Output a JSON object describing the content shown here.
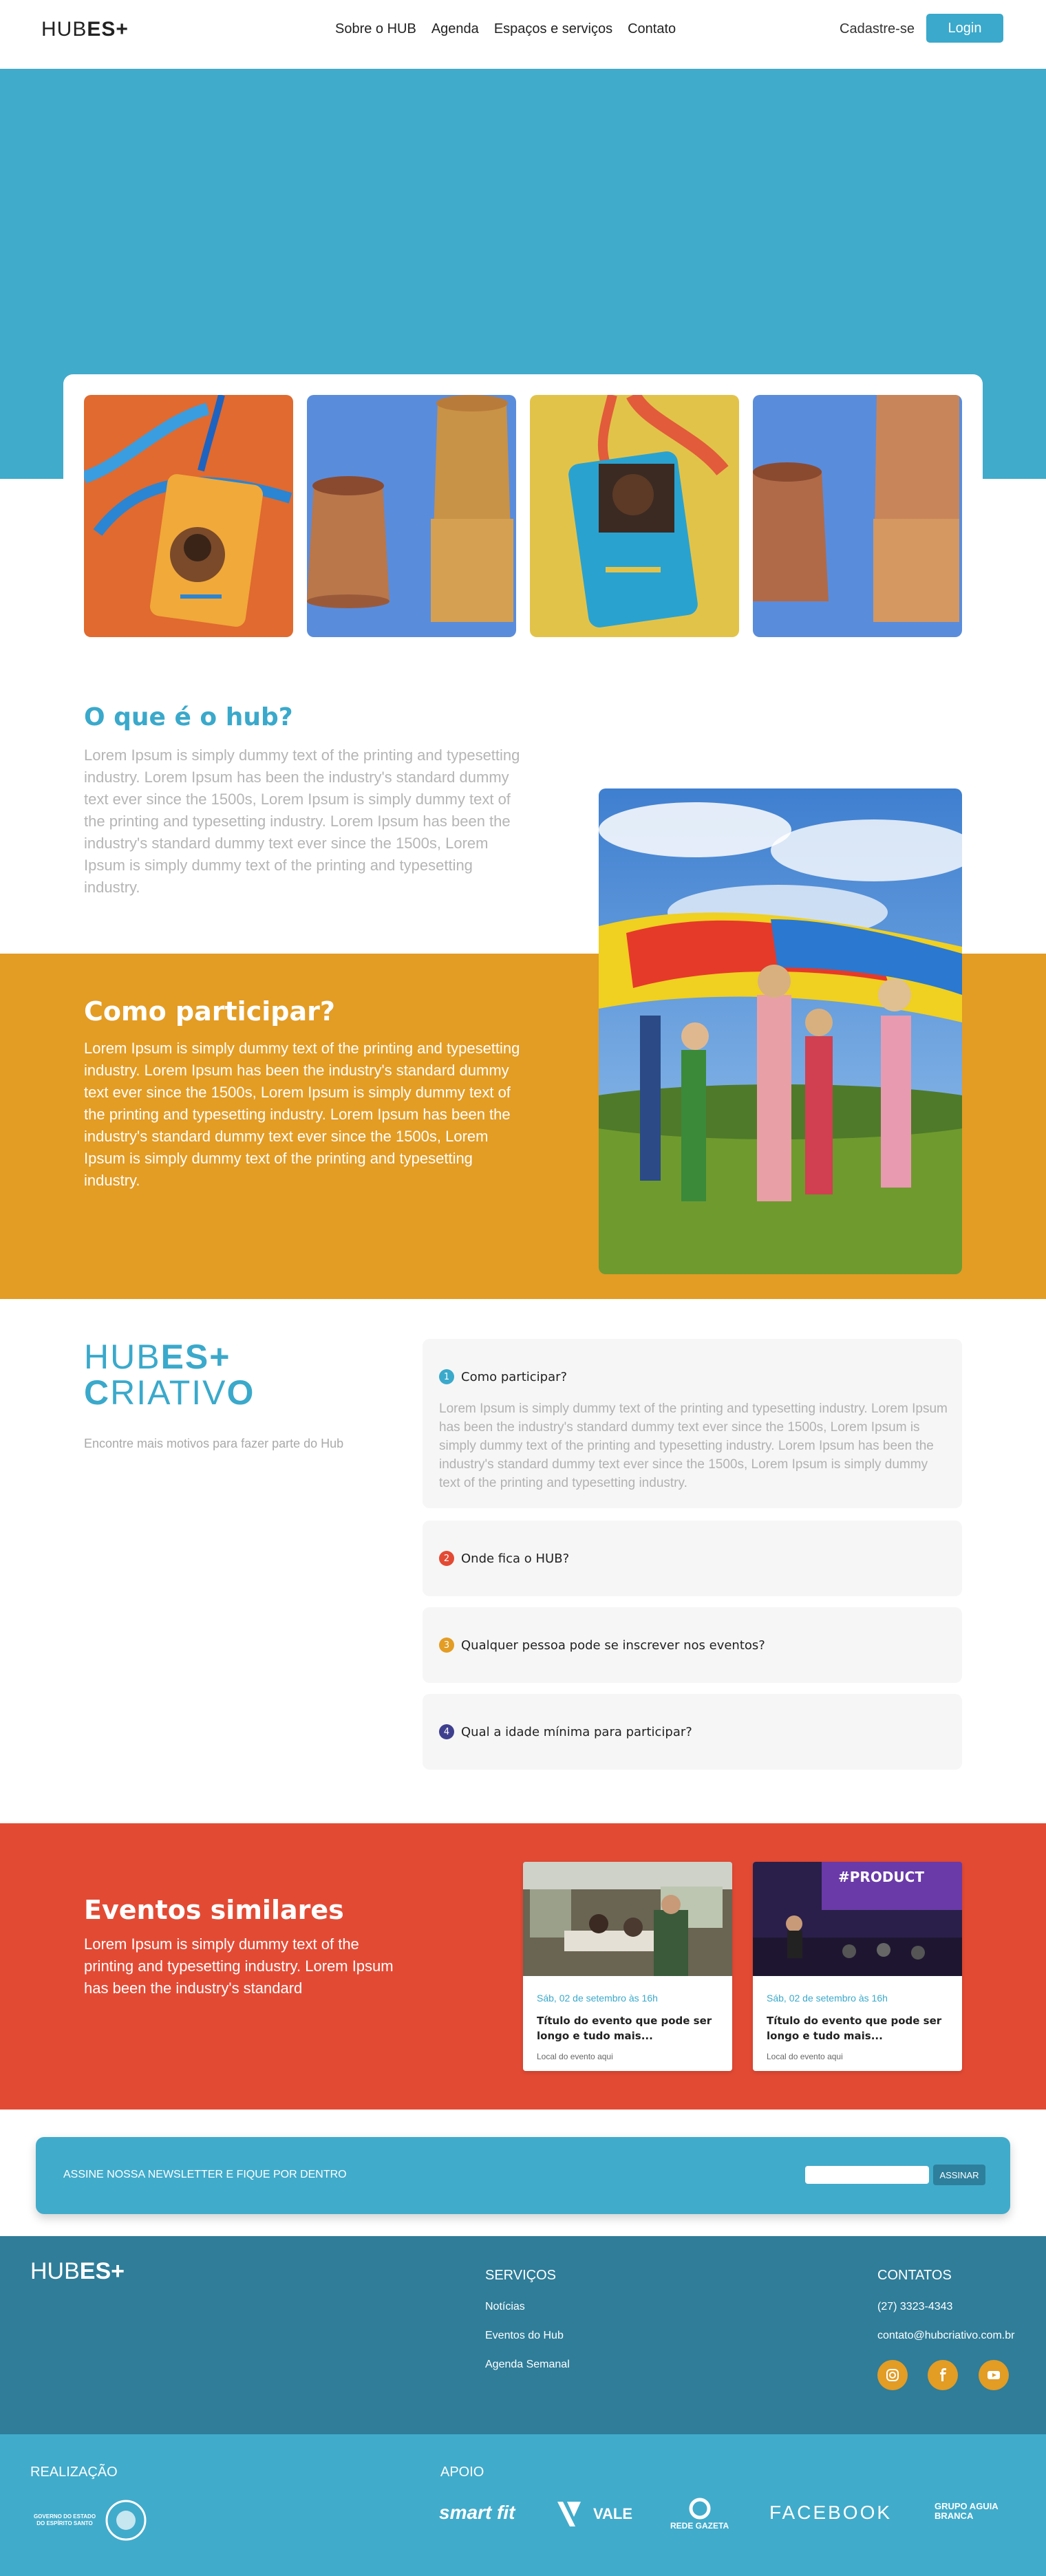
{
  "nav": {
    "logo_thin": "HUB",
    "logo_bold": "ES+",
    "links": [
      "Sobre o HUB",
      "Agenda",
      "Espaços e serviços",
      "Contato"
    ],
    "signup": "Cadastre-se",
    "login": "Login"
  },
  "about": {
    "title": "O que é o hub?",
    "text": "Lorem Ipsum is simply dummy text of the printing and typesetting industry. Lorem Ipsum has been the industry's standard dummy text ever since the 1500s, Lorem Ipsum is simply dummy text of the printing and typesetting industry. Lorem Ipsum has been the industry's standard dummy text ever since the 1500s, Lorem Ipsum is simply dummy text of the printing and typesetting industry."
  },
  "how": {
    "title": "Como participar?",
    "text": "Lorem Ipsum is simply dummy text of the printing and typesetting industry. Lorem Ipsum has been the industry's standard dummy text ever since the 1500s, Lorem Ipsum is simply dummy text of the printing and typesetting industry. Lorem Ipsum has been the industry's standard dummy text ever since the 1500s, Lorem Ipsum is simply dummy text of the printing and typesetting industry."
  },
  "creative": {
    "logo_line1_thin": "HUB",
    "logo_line1_bold": "ES+",
    "logo_line2_bold": "C",
    "logo_line2_thin": "RIATIV",
    "logo_line2_end": "O",
    "subtitle": "Encontre mais motivos para fazer parte do Hub"
  },
  "faq": [
    {
      "num": "1",
      "question": "Como participar?",
      "color": "#3aa9cb",
      "answer": "Lorem Ipsum is simply dummy text of the printing and typesetting industry. Lorem Ipsum has been the industry's standard dummy text ever since the 1500s, Lorem Ipsum is simply dummy text of the printing and typesetting industry. Lorem Ipsum has been the industry's standard dummy text ever since the 1500s, Lorem Ipsum is simply dummy text of the printing and typesetting industry."
    },
    {
      "num": "2",
      "question": "Onde fica o HUB?",
      "color": "#e34a34"
    },
    {
      "num": "3",
      "question": "Qualquer pessoa pode se inscrever nos eventos?",
      "color": "#e39c24"
    },
    {
      "num": "4",
      "question": "Qual a idade mínima para participar?",
      "color": "#3f3f8f"
    }
  ],
  "events": {
    "title": "Eventos similares",
    "text": "Lorem Ipsum is simply dummy text of the printing and typesetting industry. Lorem Ipsum has been the industry's standard",
    "cards": [
      {
        "date": "Sáb, 02 de setembro às 16h",
        "title": "Título do evento que pode ser longo e tudo mais...",
        "location": "Local do evento aqui"
      },
      {
        "date": "Sáb, 02 de setembro às 16h",
        "title": "Título do evento que pode ser longo e tudo mais...",
        "location": "Local do evento aqui",
        "banner": "#PRODUCT"
      }
    ]
  },
  "newsletter": {
    "text": "ASSINE NOSSA NEWSLETTER E FIQUE POR DENTRO",
    "button": "ASSINAR"
  },
  "footer": {
    "logo_thin": "HUB",
    "logo_bold": "ES+",
    "services_title": "SERVIÇOS",
    "services": [
      "Notícias",
      "Eventos do Hub",
      "Agenda Semanal"
    ],
    "contacts_title": "CONTATOS",
    "phone": "(27) 3323-4343",
    "email": "contato@hubcriativo.com.br",
    "social": [
      "instagram-icon",
      "facebook-icon",
      "youtube-icon"
    ]
  },
  "support": {
    "realizacao_title": "REALIZAÇÃO",
    "realizacao_org": "GOVERNO DO ESTADO DO ESPÍRITO SANTO",
    "apoio_title": "APOIO",
    "partners": [
      "smart fit",
      "VALE",
      "REDE GAZETA",
      "FACEBOOK",
      "GRUPO AGUIA BRANCA"
    ]
  },
  "colors": {
    "blue": "#41abcb",
    "orange": "#e39c24",
    "red": "#e34a34",
    "dark_blue": "#2f7d99"
  }
}
